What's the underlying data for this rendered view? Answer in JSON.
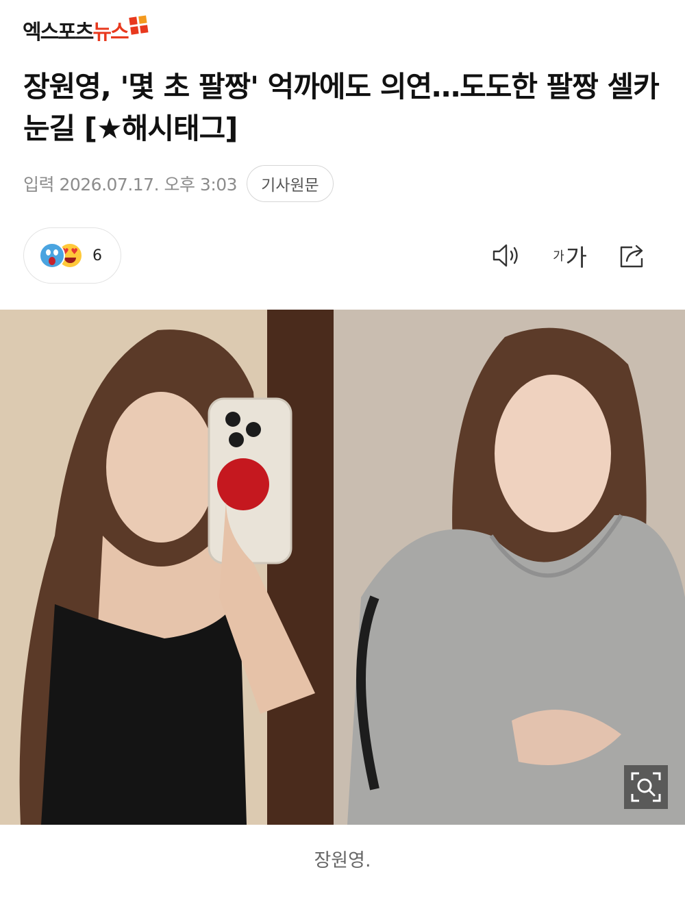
{
  "header": {
    "logo_text_dark": "엑스포츠",
    "logo_text_red": "뉴스",
    "brand_colors": {
      "red": "#e8391e",
      "orange": "#f39a1e"
    }
  },
  "article": {
    "title": "장원영, '몇 초 팔짱' 억까에도 의연…도도한 팔짱 셀카 눈길 [★해시태그]",
    "date": "입력 2026.07.17. 오후 3:03",
    "original_button": "기사원문",
    "reaction_count": "6",
    "font_size_small": "가",
    "font_size_large": "가",
    "photo_caption": "장원영."
  },
  "icons": [
    "speaker-icon",
    "font-size-icon",
    "share-icon",
    "zoom-icon"
  ]
}
